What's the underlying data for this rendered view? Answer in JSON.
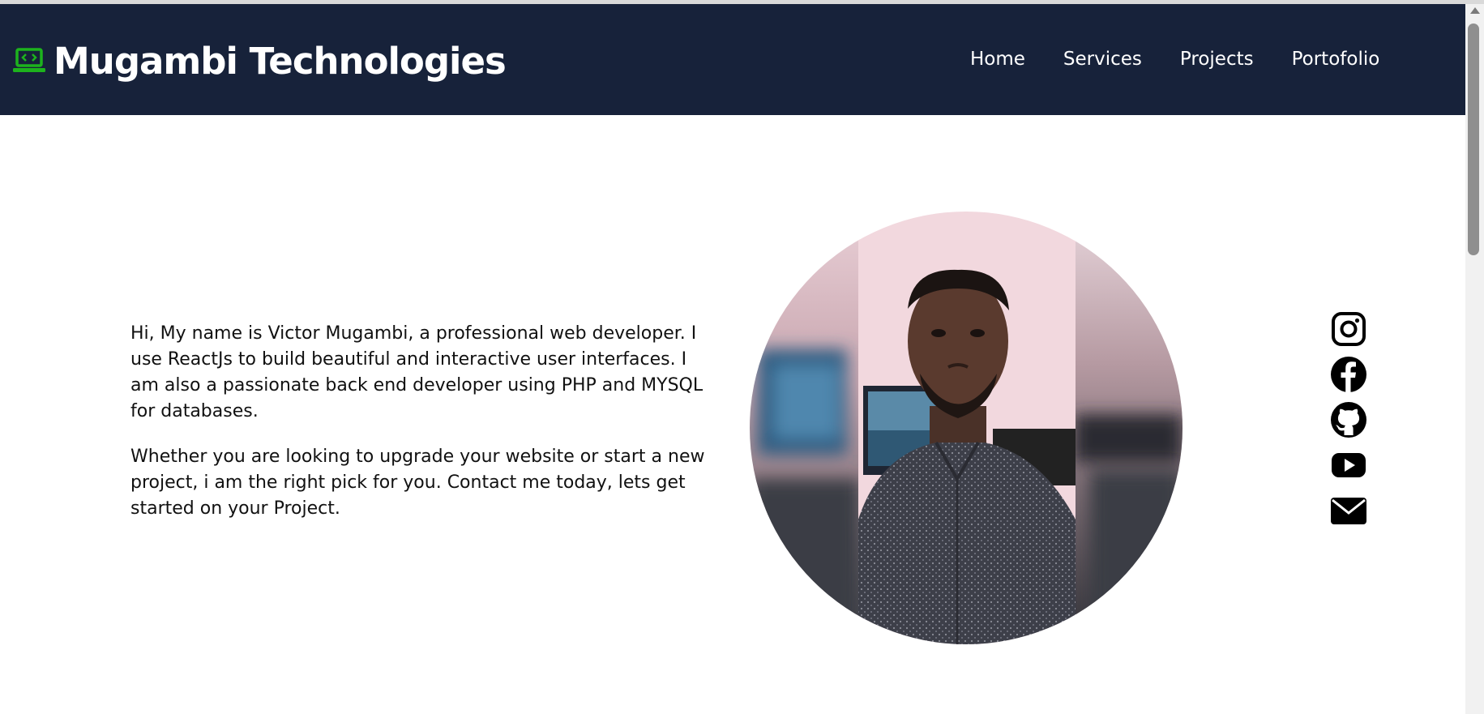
{
  "header": {
    "brand_name": "Mugambi Technologies",
    "brand_icon": "laptop-code-icon",
    "brand_icon_color": "#1db31d",
    "background": "#17223a",
    "nav": [
      {
        "label": "Home"
      },
      {
        "label": "Services"
      },
      {
        "label": "Projects"
      },
      {
        "label": "Portofolio"
      }
    ]
  },
  "hero": {
    "paragraphs": [
      "Hi, My name is Victor Mugambi, a professional web developer. I use ReactJs to build beautiful and interactive user interfaces. I am also a passionate back end developer using PHP and MYSQL for databases.",
      "Whether you are looking to upgrade your website or start a new project, i am the right pick for you. Contact me today, lets get started on your Project."
    ],
    "portrait_icon": "profile-photo"
  },
  "social": [
    {
      "icon": "instagram-icon"
    },
    {
      "icon": "facebook-icon"
    },
    {
      "icon": "github-icon"
    },
    {
      "icon": "youtube-icon"
    },
    {
      "icon": "email-icon"
    }
  ]
}
